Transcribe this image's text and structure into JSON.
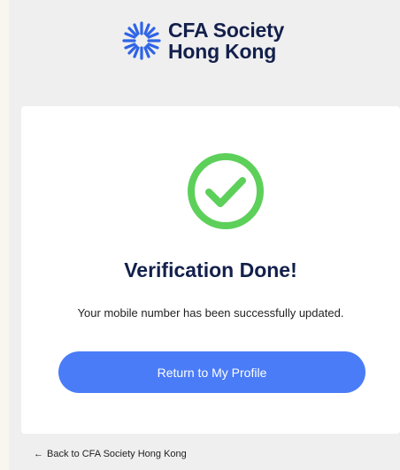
{
  "brand": {
    "line1": "CFA Society",
    "line2": "Hong Kong",
    "color": "#13204c"
  },
  "card": {
    "title": "Verification Done!",
    "message": "Your mobile number has been successfully updated.",
    "button_label": "Return to My Profile",
    "check_color": "#5dd05a",
    "button_color": "#4a7cf7"
  },
  "footer": {
    "back_link": "Back to CFA Society Hong Kong",
    "arrow": "←"
  },
  "icons": {
    "logo": "cfa-globe-logo-icon",
    "status": "check-circle-icon",
    "back": "arrow-left-icon"
  }
}
